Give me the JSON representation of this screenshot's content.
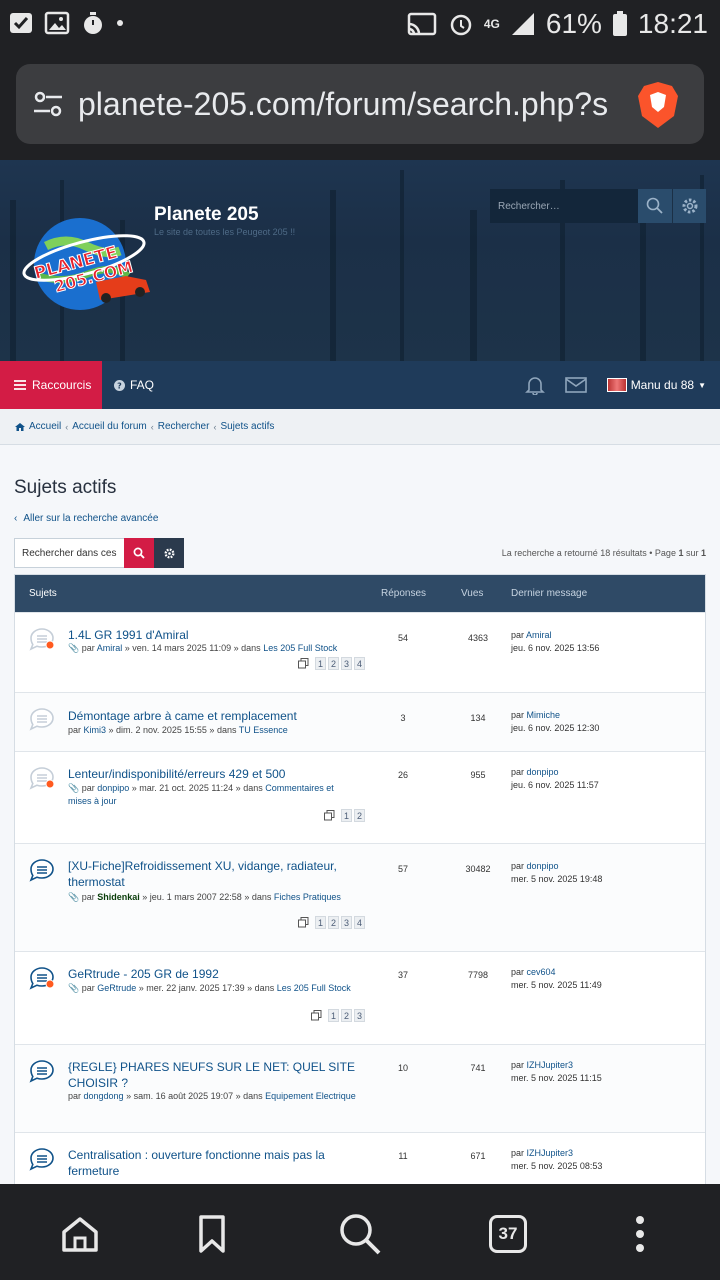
{
  "status_bar": {
    "battery": "61%",
    "time": "18:21",
    "network": "4G"
  },
  "browser": {
    "url": "planete-205.com/forum/search.php?s",
    "tab_count": "37"
  },
  "site": {
    "title": "Planete 205",
    "subtitle": "Le site de toutes les Peugeot 205 !!",
    "search_placeholder": "Rechercher…"
  },
  "nav": {
    "shortcuts": "Raccourcis",
    "faq": "FAQ",
    "user": "Manu du 88"
  },
  "breadcrumb": [
    "Accueil",
    "Accueil du forum",
    "Rechercher",
    "Sujets actifs"
  ],
  "page": {
    "heading": "Sujets actifs",
    "advanced_link": "Aller sur la recherche avancée",
    "search_in_placeholder": "Rechercher dans ces",
    "result_prefix": "La recherche a retourné 18 résultats • Page ",
    "result_page": "1",
    "result_of": " sur ",
    "result_total": "1"
  },
  "table": {
    "headers": {
      "topics": "Sujets",
      "replies": "Réponses",
      "views": "Vues",
      "last": "Dernier message"
    },
    "rows": [
      {
        "title": "1.4L GR 1991 d'Amiral",
        "by": "par ",
        "author": "Amiral",
        "date": " » ven. 14 mars 2025 11:09 » dans ",
        "forum": "Les 205 Full Stock",
        "pages": [
          "1",
          "2",
          "3",
          "4"
        ],
        "replies": "54",
        "views": "4363",
        "last_by": "Amiral",
        "last_date": "jeu. 6 nov. 2025 13:56"
      },
      {
        "title": "Démontage arbre à came et remplacement",
        "by": "par ",
        "author": "Kimi3",
        "date": " » dim. 2 nov. 2025 15:55 » dans ",
        "forum": "TU Essence",
        "pages": [],
        "replies": "3",
        "views": "134",
        "last_by": "Mimiche",
        "last_date": "jeu. 6 nov. 2025 12:30"
      },
      {
        "title": "Lenteur/indisponibilité/erreurs 429 et 500",
        "by": "par ",
        "author": "donpipo",
        "date": " » mar. 21 oct. 2025 11:24 » dans ",
        "forum": "Commentaires et mises à jour",
        "pages": [
          "1",
          "2"
        ],
        "replies": "26",
        "views": "955",
        "last_by": "donpipo",
        "last_date": "jeu. 6 nov. 2025 11:57"
      },
      {
        "title": "[XU-Fiche]Refroidissement XU, vidange, radiateur, thermostat",
        "by": "par ",
        "author": "Shidenkai",
        "date": " » jeu. 1 mars 2007 22:58 » dans ",
        "forum": "Fiches Pratiques",
        "pages": [
          "1",
          "2",
          "3",
          "4"
        ],
        "replies": "57",
        "views": "30482",
        "last_by": "donpipo",
        "last_date": "mer. 5 nov. 2025 19:48"
      },
      {
        "title": "GeRtrude - 205 GR de 1992",
        "by": "par ",
        "author": "GeRtrude",
        "date": " » mer. 22 janv. 2025 17:39 » dans ",
        "forum": "Les 205 Full Stock",
        "pages": [
          "1",
          "2",
          "3"
        ],
        "replies": "37",
        "views": "7798",
        "last_by": "cev604",
        "last_date": "mer. 5 nov. 2025 11:49"
      },
      {
        "title": "{REGLE} PHARES NEUFS SUR LE NET: QUEL SITE CHOISIR ?",
        "by": "par ",
        "author": "dongdong",
        "date": " » sam. 16 août 2025 19:07 » dans ",
        "forum": "Equipement Electrique",
        "pages": [],
        "replies": "10",
        "views": "741",
        "last_by": "IZHJupiter3",
        "last_date": "mer. 5 nov. 2025 11:15"
      },
      {
        "title": "Centralisation : ouverture fonctionne mais pas la fermeture",
        "by": "",
        "author": "",
        "date": "",
        "forum": "",
        "pages": [],
        "replies": "11",
        "views": "671",
        "last_by": "IZHJupiter3",
        "last_date": "mer. 5 nov. 2025 08:53"
      }
    ],
    "last_by_prefix": "par "
  },
  "colors": {
    "accent": "#d31c45",
    "navy": "#1f3b5a",
    "link": "#105289"
  }
}
